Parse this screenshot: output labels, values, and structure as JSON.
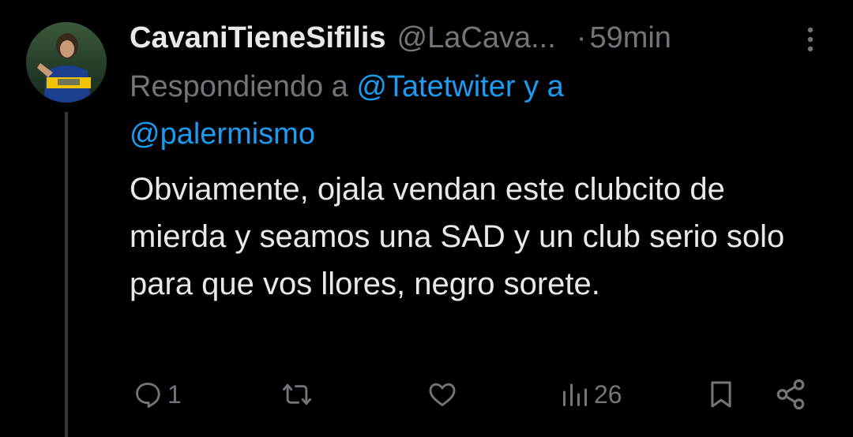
{
  "tweet": {
    "display_name": "CavaniTieneSifilis",
    "handle": "@LaCava...",
    "separator": "·",
    "time": "59min",
    "reply_prefix": "Respondiendo a ",
    "reply_mention_1": "@Tatetwiter",
    "reply_joiner": " y a",
    "reply_mention_2": "@palermismo",
    "text": "Obviamente, ojala vendan este clubcito de mierda y seamos una SAD y un club serio solo para que vos llores, negro sorete.",
    "avatar_icon": "user-avatar"
  },
  "actions": {
    "reply_count": "1",
    "retweet_count": "",
    "like_count": "",
    "views_count": "26"
  },
  "colors": {
    "background": "#000000",
    "text_primary": "#e7e9ea",
    "text_secondary": "#71767b",
    "accent": "#1d9bf0",
    "thread_line": "#333639"
  },
  "icons": {
    "more": "more-dots-vertical-icon",
    "reply": "reply-icon",
    "retweet": "retweet-icon",
    "like": "like-heart-icon",
    "views": "views-chart-icon",
    "bookmark": "bookmark-icon",
    "share": "share-icon"
  }
}
